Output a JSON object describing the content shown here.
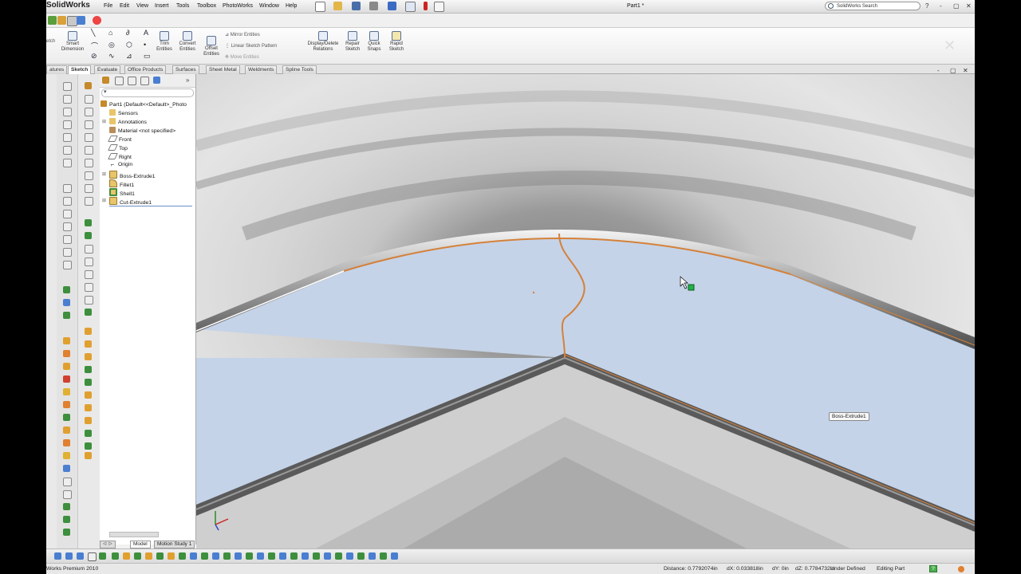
{
  "app": {
    "logo": "SolidWorks",
    "document_title": "Part1 *",
    "search_placeholder": "SolidWorks Search",
    "edition": "Works Premium 2010"
  },
  "menu": [
    "File",
    "Edit",
    "View",
    "Insert",
    "Tools",
    "Toolbox",
    "PhotoWorks",
    "Window",
    "Help"
  ],
  "window_buttons": [
    "?",
    "-",
    "▢",
    "✕"
  ],
  "command_manager": {
    "sketch_partial": "etch",
    "smart_dimension": "Smart Dimension",
    "trim_entities": "Trim Entities",
    "convert_entities": "Convert Entities",
    "offset_entities": "Offset Entities",
    "mirror_entities": "Mirror Entities",
    "linear_sketch_pattern": "Linear Sketch Pattern",
    "move_entities": "Move Entities",
    "display_delete_relations": "Display/Delete Relations",
    "repair_sketch": "Repair Sketch",
    "quick_snaps": "Quick Snaps",
    "rapid_sketch": "Rapid Sketch"
  },
  "tabs": [
    "atures",
    "Sketch",
    "Evaluate",
    "Office Products",
    "Surfaces",
    "Sheet Metal",
    "Weldments",
    "Spline Tools"
  ],
  "active_tab": "Sketch",
  "tree": {
    "root": "Part1  (Default<<Default>_Photo",
    "items": [
      "Sensors",
      "Annotations",
      "Material <not specified>",
      "Front",
      "Top",
      "Right",
      "Origin",
      "Boss-Extrude1",
      "Fillet1",
      "Shell1",
      "Cut-Extrude1"
    ]
  },
  "viewport": {
    "tooltip": "Boss-Extrude1",
    "viewport_window_buttons": [
      "-",
      "▢",
      "✕"
    ]
  },
  "bottom_tabs": [
    "Model",
    "Motion Study 1"
  ],
  "bottom_tabs_partial": "ᐊ ᐅ",
  "status": {
    "distance": "Distance: 0.7792074in",
    "dx": "dX: 0.033818in",
    "dy": "dY: 0in",
    "dz": "dZ: 0.7784732in",
    "sketch_state": "Under Defined",
    "mode": "Editing Part",
    "help": "?"
  },
  "colors": {
    "accent_orange": "#d4813a",
    "surface_blue": "#c5d3e8",
    "wall_gray": "#5f5f5f",
    "handle_green": "#22b14c"
  }
}
